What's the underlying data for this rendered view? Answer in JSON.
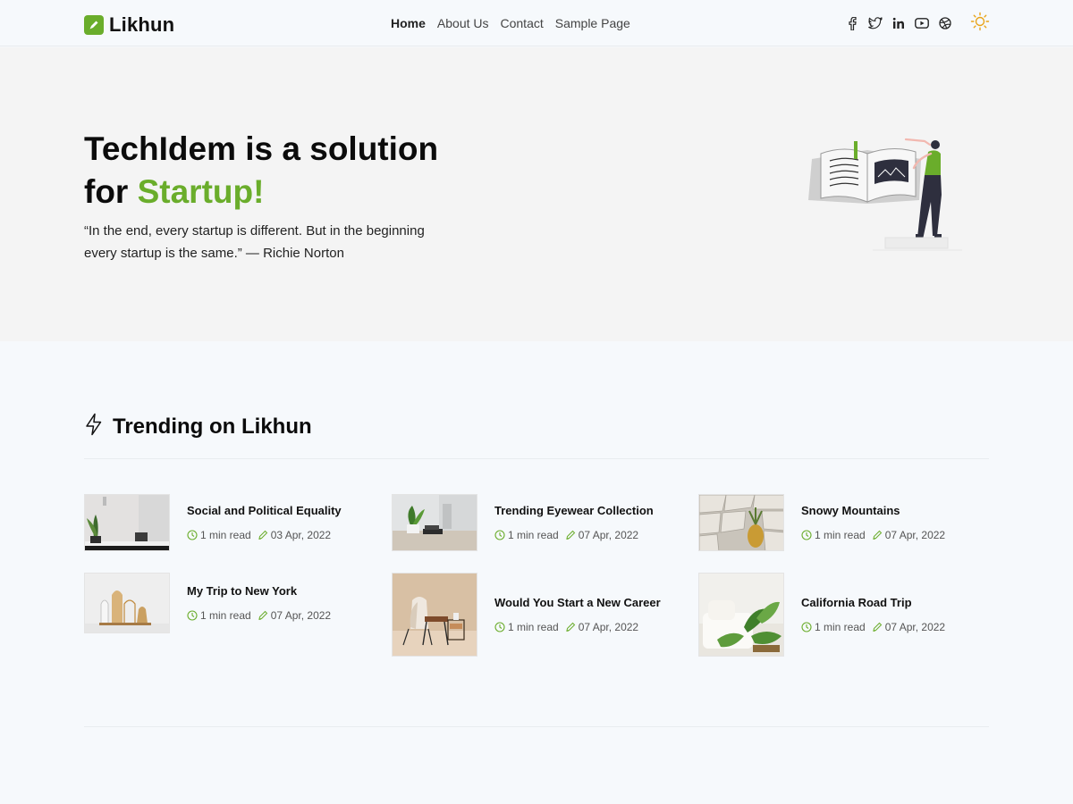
{
  "site": {
    "brand": "Likhun"
  },
  "nav": [
    {
      "label": "Home",
      "active": true
    },
    {
      "label": "About Us"
    },
    {
      "label": "Contact"
    },
    {
      "label": "Sample Page"
    }
  ],
  "social_icons": [
    "facebook-icon",
    "twitter-icon",
    "linkedin-icon",
    "youtube-icon",
    "dribbble-icon"
  ],
  "theme_toggle_icon": "sun-icon",
  "hero": {
    "title_line1": "TechIdem is a solution",
    "title_line2_prefix": "for ",
    "title_line2_accent": "Startup!",
    "quote": "“In the end, every startup is different. But in the beginning every startup is the same.” — Richie Norton"
  },
  "trending": {
    "title": "Trending on Likhun",
    "icon": "lightning-icon",
    "posts": [
      {
        "title": "Social and Political Equality",
        "read": "1 min read",
        "date": "03 Apr, 2022"
      },
      {
        "title": "Trending Eyewear Collection",
        "read": "1 min read",
        "date": "07 Apr, 2022"
      },
      {
        "title": "Snowy Mountains",
        "read": "1 min read",
        "date": "07 Apr, 2022"
      },
      {
        "title": "My Trip to New York",
        "read": "1 min read",
        "date": "07 Apr, 2022"
      },
      {
        "title": "Would You Start a New Career",
        "read": "1 min read",
        "date": "07 Apr, 2022"
      },
      {
        "title": "California Road Trip",
        "read": "1 min read",
        "date": "07 Apr, 2022"
      }
    ]
  },
  "colors": {
    "accent": "#6aad2b",
    "sun": "#e8a317"
  }
}
